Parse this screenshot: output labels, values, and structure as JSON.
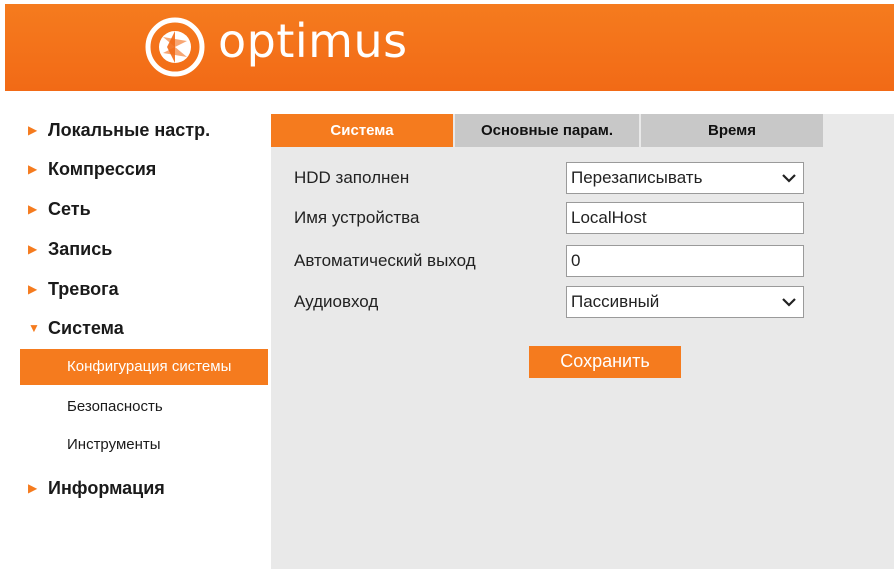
{
  "header": {
    "brand": "optimus",
    "color": "#f57b1e"
  },
  "sidebar": {
    "items": [
      {
        "label": "Локальные настр."
      },
      {
        "label": "Компрессия"
      },
      {
        "label": "Сеть"
      },
      {
        "label": "Запись"
      },
      {
        "label": "Тревога"
      },
      {
        "label": "Система",
        "expanded": true,
        "children": [
          {
            "label": "Конфигурация системы",
            "active": true
          },
          {
            "label": "Безопасность"
          },
          {
            "label": "Инструменты"
          }
        ]
      },
      {
        "label": "Информация"
      }
    ]
  },
  "tabs": [
    {
      "label": "Система",
      "active": true
    },
    {
      "label": "Основные парам."
    },
    {
      "label": "Время"
    }
  ],
  "form": {
    "hdd_full": {
      "label": "HDD заполнен",
      "value": "Перезаписывать"
    },
    "device_name": {
      "label": "Имя устройства",
      "value": "LocalHost"
    },
    "auto_logout": {
      "label": "Автоматический выход",
      "value": "0"
    },
    "audio_in": {
      "label": "Аудиовход",
      "value": "Пассивный"
    }
  },
  "save_label": "Сохранить"
}
